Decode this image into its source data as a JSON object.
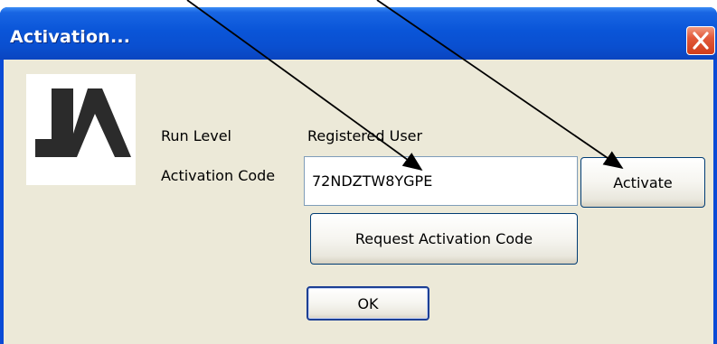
{
  "window": {
    "title": "Activation...",
    "close_glyph": "✕"
  },
  "logo": {
    "icon": "ja-logo-icon"
  },
  "info": {
    "run_level_label": "Run Level",
    "run_level_value": "Registered User",
    "activation_code_label": "Activation Code"
  },
  "activation_code": {
    "value": "72NDZTW8YGPE"
  },
  "buttons": {
    "activate": "Activate",
    "request": "Request Activation Code",
    "ok": "OK"
  },
  "annotations": {
    "arrow_icon": "annotation-arrow-icon"
  }
}
